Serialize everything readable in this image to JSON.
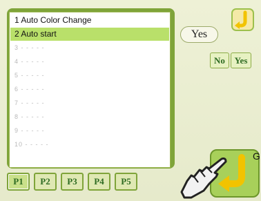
{
  "list": {
    "items": [
      {
        "text": "1 Auto Color Change"
      },
      {
        "text": "2 Auto start"
      },
      {
        "text": "3 - - - - -"
      },
      {
        "text": "4 - - - - -"
      },
      {
        "text": "5 - - - - -"
      },
      {
        "text": "6 - - - - -"
      },
      {
        "text": "7 - - - - -"
      },
      {
        "text": "8 - - - - -"
      },
      {
        "text": "9 - - - - -"
      },
      {
        "text": "10 - - - - -"
      }
    ],
    "selected_index": 1
  },
  "current_setting": {
    "value": "Yes"
  },
  "choices": {
    "no_label": "No",
    "yes_label": "Yes"
  },
  "pages": [
    {
      "label": "P1"
    },
    {
      "label": "P2"
    },
    {
      "label": "P3"
    },
    {
      "label": "P4"
    },
    {
      "label": "P5"
    }
  ],
  "g_button": {
    "label": "G",
    "icon": "return-arrow-icon"
  },
  "corner_icon": {
    "icon": "return-arrow-icon"
  },
  "pointer": {
    "icon": "pointing-hand-icon"
  },
  "colors": {
    "accent_green": "#7fa43a",
    "selected_row": "#b9e06a",
    "arrow_yellow": "#f2c300"
  }
}
